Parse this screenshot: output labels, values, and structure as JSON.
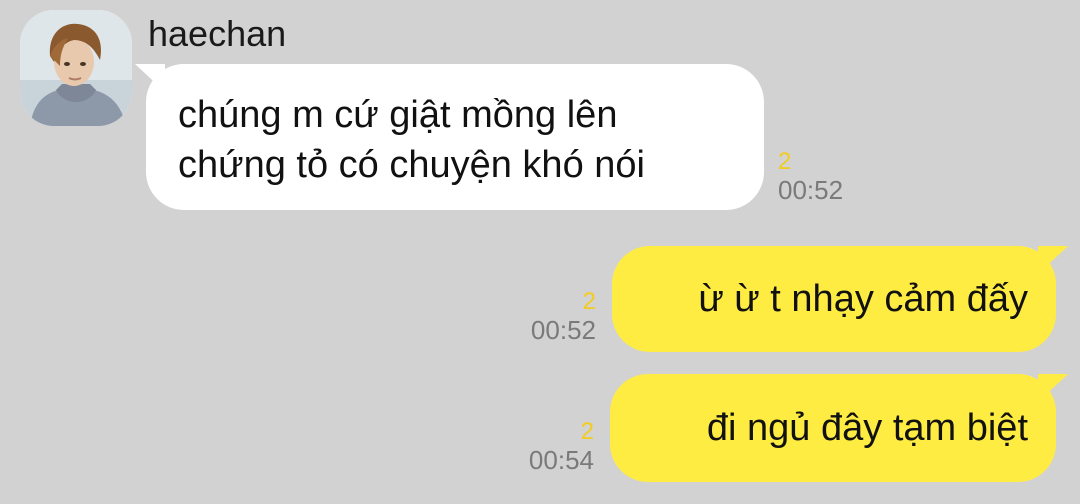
{
  "chat": {
    "sender_name": "haechan",
    "messages": [
      {
        "direction": "incoming",
        "text": "chúng m cứ giật mồng lên\nchứng tỏ có chuyện khó nói",
        "unread": "2",
        "time": "00:52"
      },
      {
        "direction": "outgoing",
        "text": "ừ ừ t nhạy cảm đấy",
        "unread": "2",
        "time": "00:52"
      },
      {
        "direction": "outgoing",
        "text": "đi ngủ đây tạm biệt",
        "unread": "2",
        "time": "00:54"
      }
    ]
  },
  "colors": {
    "background": "#d2d2d2",
    "incoming_bubble": "#ffffff",
    "outgoing_bubble": "#ffec42",
    "unread_count": "#f2cc1e",
    "timestamp": "#7a7a7a"
  },
  "icons": {
    "avatar": "profile-photo"
  }
}
